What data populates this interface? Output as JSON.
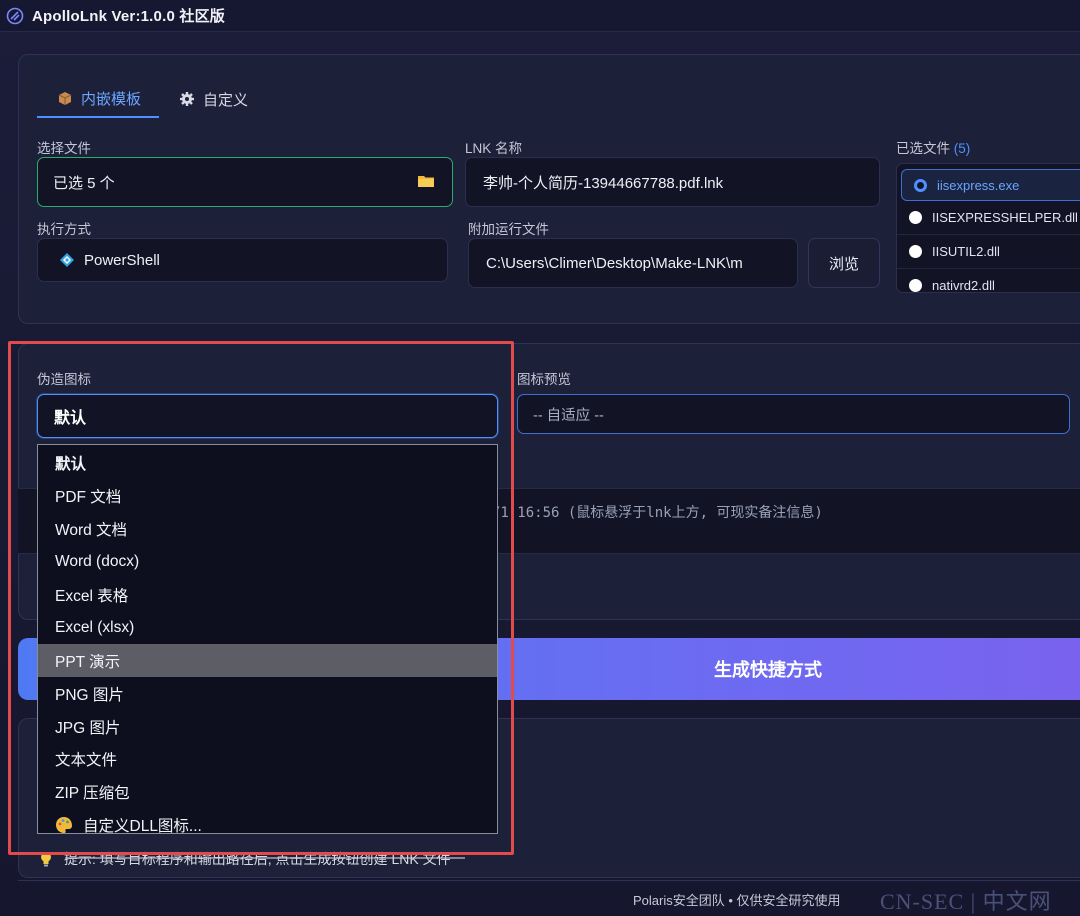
{
  "app": {
    "title": "ApolloLnk Ver:1.0.0 社区版"
  },
  "tabs": [
    {
      "label": "内嵌模板",
      "active": true,
      "icon": "box-icon"
    },
    {
      "label": "自定义",
      "active": false,
      "icon": "gear-icon"
    }
  ],
  "select_file": {
    "label": "选择文件",
    "value": "已选 5 个",
    "icon": "folder-icon"
  },
  "lnk_name": {
    "label": "LNK 名称",
    "value": "李帅-个人简历-13944667788.pdf.lnk"
  },
  "selected_files": {
    "label": "已选文件",
    "count": "(5)",
    "items": [
      {
        "name": "iisexpress.exe",
        "selected": true
      },
      {
        "name": "IISEXPRESSHELPER.dll",
        "selected": false
      },
      {
        "name": "IISUTIL2.dll",
        "selected": false
      },
      {
        "name": "nativrd2.dll",
        "selected": false
      }
    ]
  },
  "exec_mode": {
    "label": "执行方式",
    "value": "PowerShell",
    "icon": "powershell-icon"
  },
  "extra_file": {
    "label": "附加运行文件",
    "value": "C:\\Users\\Climer\\Desktop\\Make-LNK\\m",
    "browse_label": "浏览"
  },
  "fake_icon": {
    "label": "伪造图标",
    "value": "默认",
    "options": [
      "默认",
      "PDF 文档",
      "Word 文档",
      "Word (docx)",
      "Excel 表格",
      "Excel (xlsx)",
      "PPT 演示",
      "PNG 图片",
      "JPG 图片",
      "文本文件",
      "ZIP 压缩包",
      "自定义DLL图标..."
    ],
    "highlighted": "PPT 演示"
  },
  "icon_preview": {
    "label": "图标预览",
    "value": "-- 自适应 --"
  },
  "remark": {
    "text": "/1 16:56 (鼠标悬浮于lnk上方, 可现实备注信息)"
  },
  "generate": {
    "label": "生成快捷方式"
  },
  "hint": {
    "text": "提示: 填写目标程序和输出路径后, 点击生成按钮创建 LNK 文件"
  },
  "footer": {
    "text": "Polaris安全团队 • 仅供安全研究使用"
  },
  "watermark": {
    "text": "CN-SEC | 中文网"
  },
  "colors": {
    "accent": "#4f8fff",
    "success": "#2ea96f",
    "highlight": "#e24b4b"
  }
}
